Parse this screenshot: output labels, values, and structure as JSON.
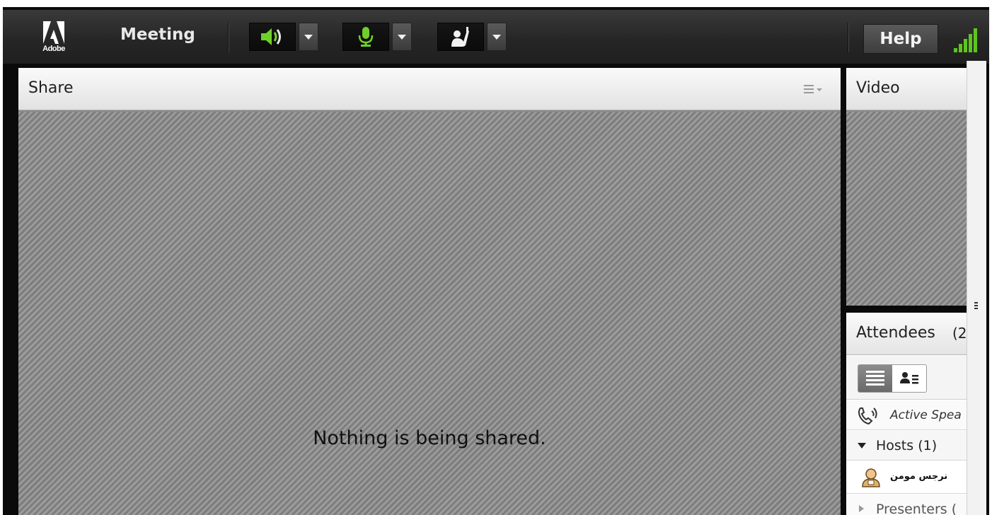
{
  "toolbar": {
    "logo_text": "Adobe",
    "menu_label": "Meeting",
    "help_label": "Help",
    "speaker_icon": "speaker-icon",
    "mic_icon": "microphone-icon",
    "raise_hand_icon": "raise-hand-icon",
    "signal_icon": "connection-signal-icon",
    "accent_green": "#6ed12a"
  },
  "share": {
    "title": "Share",
    "message": "Nothing is being shared.",
    "options_icon": "pod-menu-icon"
  },
  "video": {
    "title": "Video"
  },
  "attendees": {
    "title": "Attendees",
    "count_partial": "(2",
    "active_speakers_label": "Active Spea",
    "hosts_label": "Hosts (1)",
    "host_user_name": "نرجس مومن",
    "presenters_label": "Presenters ("
  }
}
